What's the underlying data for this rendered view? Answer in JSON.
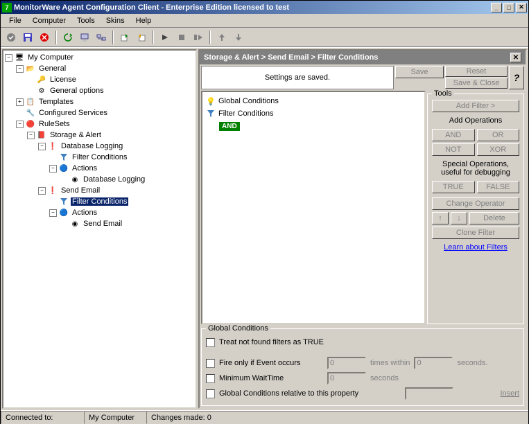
{
  "title": "MonitorWare Agent Configuration Client - Enterprise Edition licensed to test",
  "menu": {
    "file": "File",
    "computer": "Computer",
    "tools": "Tools",
    "skins": "Skins",
    "help": "Help"
  },
  "tree": {
    "root": "My Computer",
    "general": "General",
    "license": "License",
    "general_options": "General options",
    "templates": "Templates",
    "configured_services": "Configured Services",
    "rulesets": "RuleSets",
    "storage_alert": "Storage & Alert",
    "database_logging": "Database Logging",
    "filter_conditions": "Filter Conditions",
    "actions": "Actions",
    "db_logging_action": "Database Logging",
    "send_email": "Send Email",
    "send_email_action": "Send Email"
  },
  "breadcrumb": "Storage & Alert > Send Email > Filter Conditions",
  "status_msg": "Settings are saved.",
  "buttons": {
    "save": "Save",
    "reset": "Reset",
    "save_close": "Save & Close",
    "add_filter": "Add Filter >",
    "add_operations": "Add Operations",
    "and": "AND",
    "or": "OR",
    "not": "NOT",
    "xor": "XOR",
    "true": "TRUE",
    "false": "FALSE",
    "change_operator": "Change Operator",
    "delete": "Delete",
    "clone_filter": "Clone Filter",
    "insert": "Insert"
  },
  "tools_label": "Tools",
  "special_ops": "Special Operations, useful for debugging",
  "learn_link": "Learn about Filters",
  "filter_tree": {
    "global_conditions": "Global Conditions",
    "filter_conditions": "Filter Conditions",
    "and": "AND"
  },
  "global": {
    "title": "Global Conditions",
    "treat_true": "Treat not found filters as TRUE",
    "fire_only": "Fire only if Event occurs",
    "times_within": "times within",
    "seconds": "seconds.",
    "min_wait": "Minimum WaitTime",
    "seconds2": "seconds",
    "relative": "Global Conditions relative to this property",
    "zero": "0"
  },
  "statusbar": {
    "connected": "Connected to:",
    "computer": "My Computer",
    "changes": "Changes made: 0"
  }
}
